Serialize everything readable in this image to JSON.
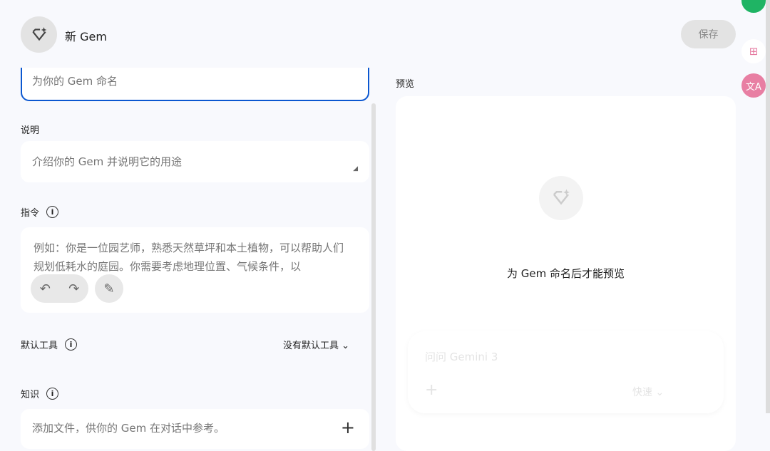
{
  "header": {
    "title": "新 Gem",
    "save_label": "保存"
  },
  "name_input": {
    "placeholder": "为你的 Gem 命名"
  },
  "description": {
    "label": "说明",
    "placeholder": "介绍你的 Gem 并说明它的用途"
  },
  "instructions": {
    "label": "指令",
    "placeholder": "例如：你是一位园艺师，熟悉天然草坪和本土植物，可以帮助人们规划低耗水的庭园。你需要考虑地理位置、气候条件，以"
  },
  "default_tools": {
    "label": "默认工具",
    "value": "没有默认工具"
  },
  "knowledge": {
    "label": "知识",
    "placeholder": "添加文件，供你的 Gem 在对话中参考。"
  },
  "preview": {
    "label": "预览",
    "message": "为 Gem 命名后才能预览",
    "chat_placeholder": "问问 Gemini 3",
    "mode": "快速"
  }
}
